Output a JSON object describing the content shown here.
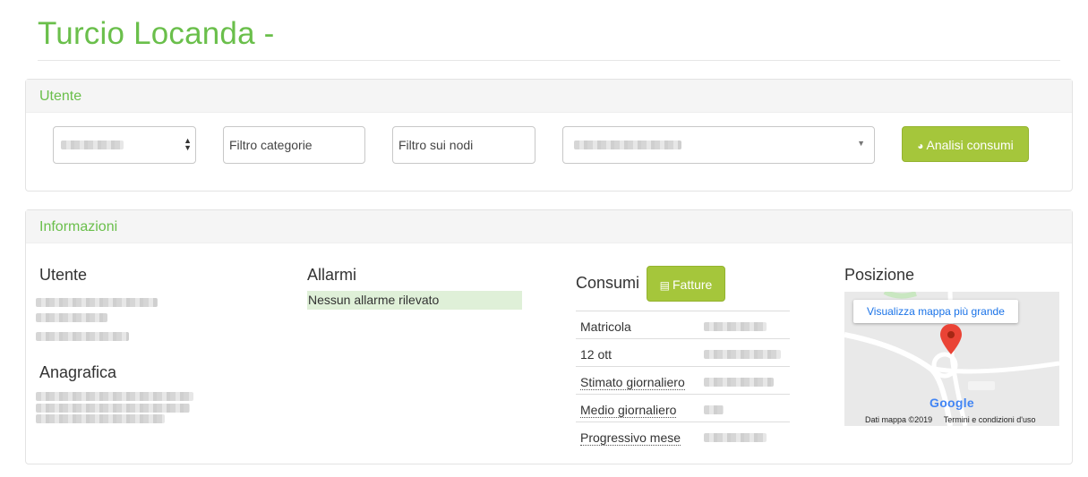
{
  "page": {
    "title": "Turcio Locanda -"
  },
  "utente_panel": {
    "heading": "Utente",
    "filter_categories_placeholder": "Filtro categorie",
    "filter_nodes_placeholder": "Filtro sui nodi",
    "analyze_button": "Analisi consumi"
  },
  "info_panel": {
    "heading": "Informazioni",
    "utente_title": "Utente",
    "anagrafica_title": "Anagrafica",
    "allarmi_title": "Allarmi",
    "alarm_status": "Nessun allarme rilevato",
    "consumi_title": "Consumi",
    "fatture_button": "Fatture",
    "consumi_rows": [
      {
        "label": "Matricola"
      },
      {
        "label": "12 ott"
      },
      {
        "label": "Stimato giornaliero"
      },
      {
        "label": "Medio giornaliero"
      },
      {
        "label": "Progressivo mese"
      }
    ],
    "posizione_title": "Posizione",
    "map": {
      "larger_map_link": "Visualizza mappa più grande",
      "map_data": "Dati mappa ©2019",
      "terms": "Termini e condizioni d'uso",
      "logo": "Google"
    }
  },
  "colors": {
    "brand_green": "#6abf4b",
    "button_green": "#a5c63b",
    "alarm_ok_bg": "#dff0d8"
  }
}
